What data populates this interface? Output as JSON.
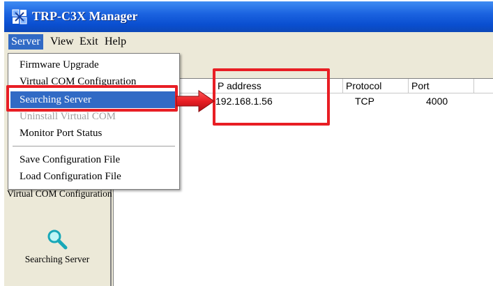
{
  "window": {
    "title": "TRP-C3X Manager"
  },
  "menubar": {
    "items": [
      {
        "label": "Server"
      },
      {
        "label": "View"
      },
      {
        "label": "Exit"
      },
      {
        "label": "Help"
      }
    ]
  },
  "server_menu": {
    "items": [
      {
        "label": "Firmware Upgrade"
      },
      {
        "label": "Virtual COM Configuration"
      },
      {
        "label": "Searching Server"
      },
      {
        "label": "Uninstall Virtual COM"
      },
      {
        "label": "Monitor Port Status"
      },
      {
        "label": "Save Configuration File"
      },
      {
        "label": "Load Configuration File"
      }
    ]
  },
  "sidebar": {
    "items": [
      {
        "label": "Virtual COM Configuration",
        "icon": "virtual-com-icon"
      },
      {
        "label": "Searching Server",
        "icon": "magnifier-icon"
      }
    ]
  },
  "server_list": {
    "columns": [
      "P address",
      "Protocol",
      "Port"
    ],
    "rows": [
      {
        "ip": "192.168.1.56",
        "protocol": "TCP",
        "port": "4000"
      }
    ]
  },
  "colors": {
    "title_bar": "#0a4fd1",
    "menu_highlight": "#316ac5",
    "annotation_red": "#e81e24"
  }
}
